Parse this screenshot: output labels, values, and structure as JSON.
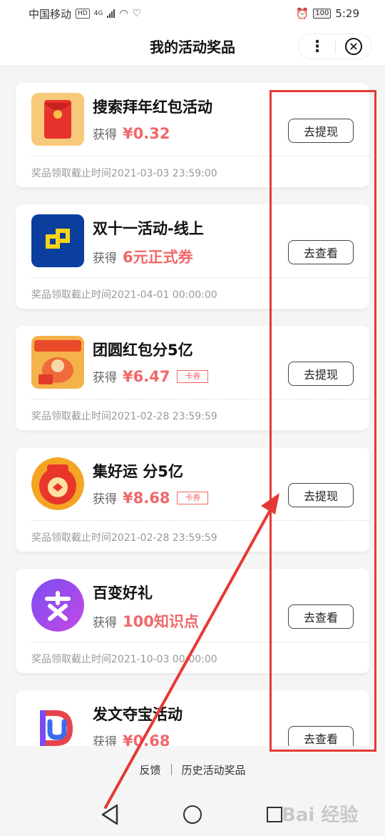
{
  "status_bar": {
    "carrier": "中国移动",
    "hd_badge": "HD",
    "network": "4G",
    "battery": "100",
    "time": "5:29"
  },
  "header": {
    "title": "我的活动奖品",
    "more_label": "⋮",
    "close_label": "×"
  },
  "labels": {
    "got": "获得",
    "deadline_prefix": "奖品领取截止时间"
  },
  "activities": [
    {
      "name": "搜索拜年红包活动",
      "prize": "¥0.32",
      "tag": "",
      "button": "去提现",
      "deadline": "奖品领取截止时间2021-03-03 23:59:00",
      "icon": "red-envelope-icon"
    },
    {
      "name": "双十一活动-线上",
      "prize": "6元正式券",
      "tag": "",
      "button": "去查看",
      "deadline": "奖品领取截止时间2021-04-01 00:00:00",
      "icon": "blue-square-logo-icon"
    },
    {
      "name": "团圆红包分5亿",
      "prize": "¥6.47",
      "tag": "卡券",
      "button": "去提现",
      "deadline": "奖品领取截止时间2021-02-28 23:59:59",
      "icon": "reunion-red-packet-icon"
    },
    {
      "name": "集好运 分5亿",
      "prize": "¥8.68",
      "tag": "卡券",
      "button": "去提现",
      "deadline": "奖品领取截止时间2021-02-28 23:59:59",
      "icon": "lucky-bag-icon"
    },
    {
      "name": "百变好礼",
      "prize": "100知识点",
      "tag": "",
      "button": "去查看",
      "deadline": "奖品领取截止时间2021-10-03 00:00:00",
      "icon": "purple-bian-icon"
    },
    {
      "name": "发文夺宝活动",
      "prize": "¥0.68",
      "tag": "",
      "button": "去查看",
      "deadline": "",
      "icon": "du-logo-icon"
    }
  ],
  "footer": {
    "feedback": "反馈",
    "history": "历史活动奖品"
  },
  "watermark": "Bai 经验",
  "colors": {
    "accent_red": "#f0686a",
    "annotation_red": "#e53935"
  }
}
